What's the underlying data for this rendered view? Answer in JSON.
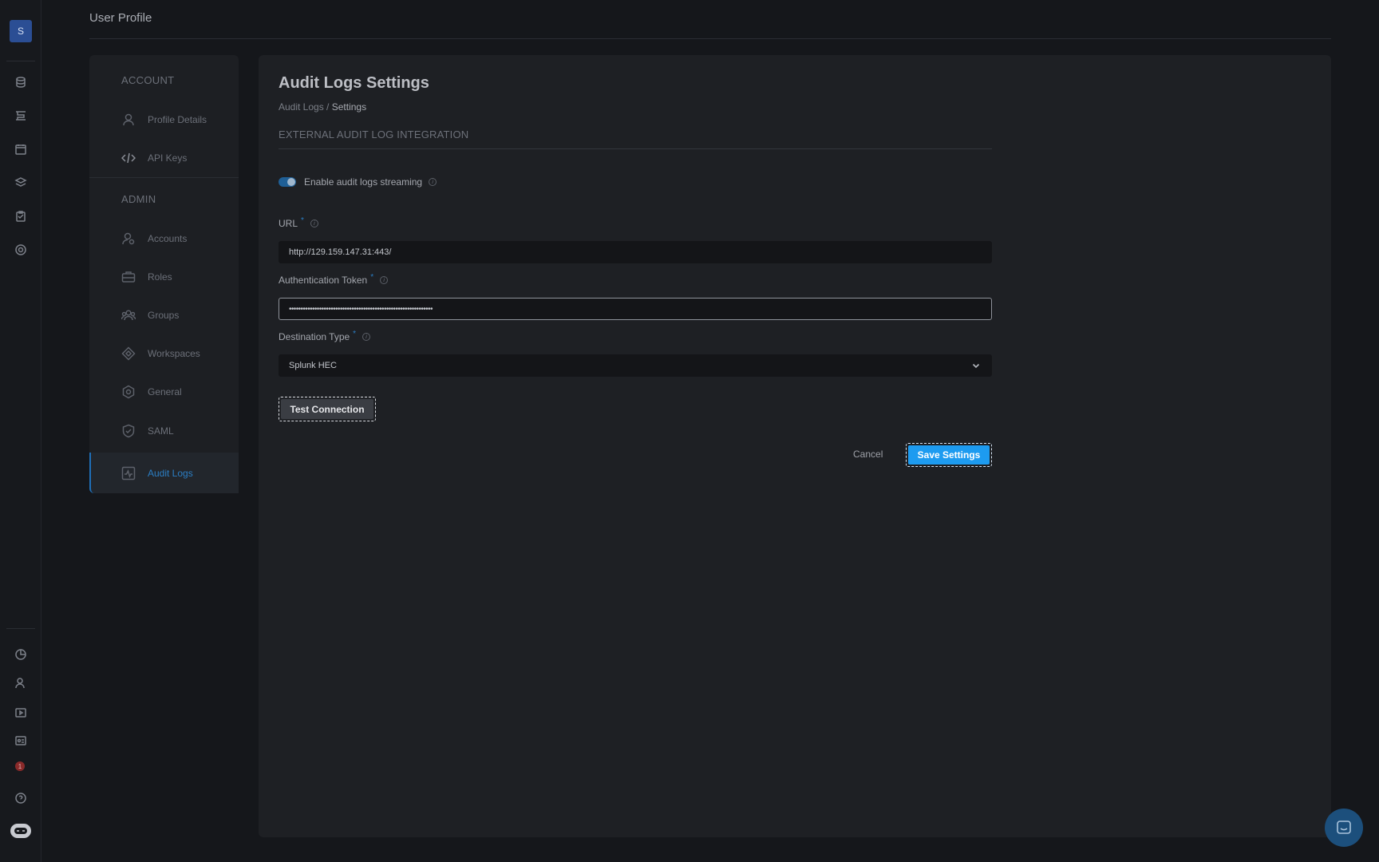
{
  "rail": {
    "avatar_letter": "S",
    "icons": [
      "database-icon",
      "pipeline-icon",
      "calendar-icon",
      "layers-icon",
      "clipboard-icon",
      "settings-icon",
      "pie-chart-icon",
      "user-icon",
      "video-icon",
      "id-card-icon",
      "notification-icon",
      "help-icon",
      "robot-icon"
    ],
    "notification_count": "1"
  },
  "header": {
    "title": "User Profile"
  },
  "nav": {
    "account_heading": "ACCOUNT",
    "admin_heading": "ADMIN",
    "items": [
      {
        "label": "Profile Details",
        "icon": "user-icon"
      },
      {
        "label": "API Keys",
        "icon": "code-icon"
      },
      {
        "label": "Accounts",
        "icon": "accounts-icon"
      },
      {
        "label": "Roles",
        "icon": "briefcase-icon"
      },
      {
        "label": "Groups",
        "icon": "groups-icon"
      },
      {
        "label": "Workspaces",
        "icon": "diamond-icon"
      },
      {
        "label": "General",
        "icon": "gear-icon"
      },
      {
        "label": "SAML",
        "icon": "shield-icon"
      },
      {
        "label": "Audit Logs",
        "icon": "activity-icon"
      }
    ],
    "active": "Audit Logs"
  },
  "main": {
    "title": "Audit Logs Settings",
    "breadcrumb": {
      "parent": "Audit Logs",
      "separator": " / ",
      "current": "Settings"
    },
    "section_title": "EXTERNAL AUDIT LOG INTEGRATION",
    "toggle": {
      "label": "Enable audit logs streaming",
      "enabled": true
    },
    "url": {
      "label": "URL",
      "required_mark": "*",
      "value": "http://129.159.147.31:443/"
    },
    "token": {
      "label": "Authentication Token",
      "required_mark": "*",
      "value": "••••••••••••••••••••••••••••••••••••••••••••••••••••••••••••••"
    },
    "destination": {
      "label": "Destination Type",
      "required_mark": "*",
      "value": "Splunk HEC"
    },
    "info_glyph": "i",
    "test_button": "Test Connection",
    "cancel_button": "Cancel",
    "save_button": "Save Settings"
  },
  "colors": {
    "accent": "#1d9bf0",
    "active_nav": "#2b7ec4",
    "background": "#15171b",
    "panel": "#1e2024"
  }
}
